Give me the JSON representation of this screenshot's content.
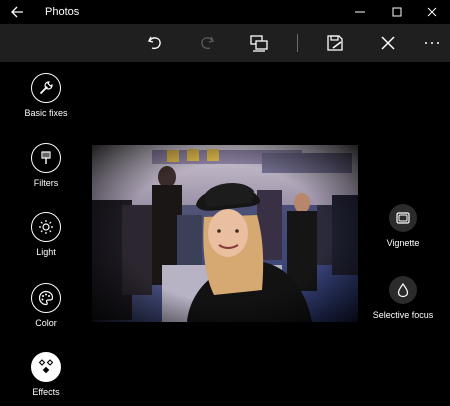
{
  "window": {
    "title": "Photos"
  },
  "toolbar": {
    "undo_icon": "undo-icon",
    "redo_icon": "redo-icon",
    "compare_icon": "compare-icon",
    "save_icon": "save-copy-icon",
    "cancel_icon": "close-icon",
    "more_icon": "more-icon"
  },
  "tools": {
    "basic_fixes": "Basic fixes",
    "filters": "Filters",
    "light": "Light",
    "color": "Color",
    "effects": "Effects"
  },
  "effects": {
    "vignette": "Vignette",
    "selective_focus": "Selective focus"
  },
  "colors": {
    "background": "#000000",
    "command_bar": "#1f1f1f",
    "option_circle": "#2b2b2b",
    "accent": "#ffffff"
  }
}
